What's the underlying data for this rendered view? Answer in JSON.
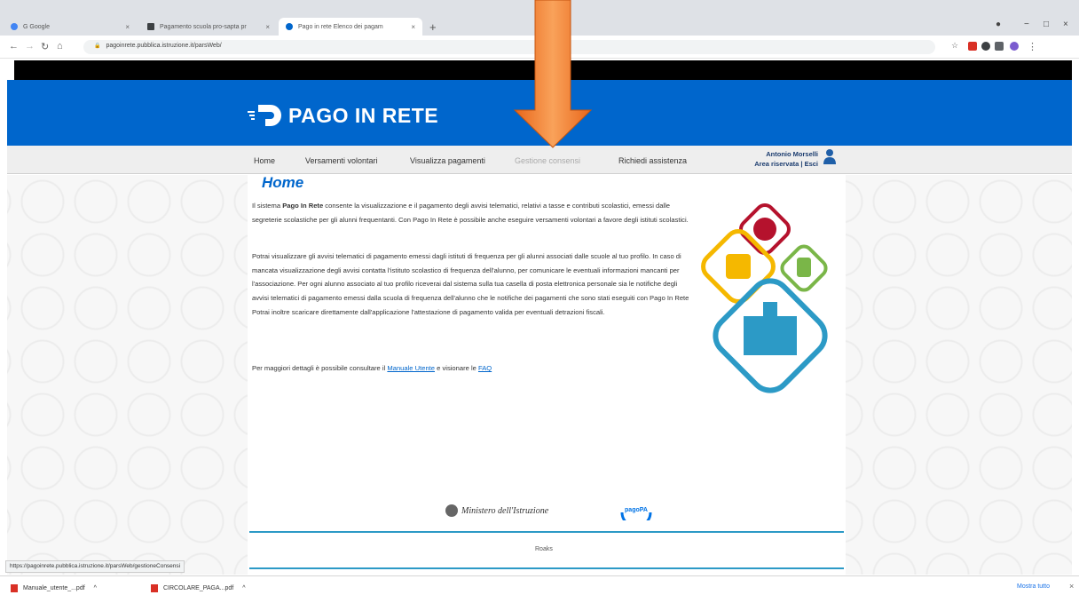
{
  "browser": {
    "tabs": [
      {
        "label": "G Google",
        "active": false,
        "favicon_color": "#4285f4"
      },
      {
        "label": "Pagamento scuola pro-sapta pr",
        "active": false,
        "favicon_color": "#3c4043"
      },
      {
        "label": "Pago in rete Elenco dei pagam",
        "active": true,
        "favicon_color": "#0066cc"
      }
    ],
    "url": "pagoinrete.pubblica.istruzione.it/parsWeb/",
    "new_tab_symbol": "+",
    "window_controls": {
      "minimize": "−",
      "maximize": "□",
      "close": "×"
    }
  },
  "site": {
    "logo_text": "PAGO IN RETE",
    "brand_color": "#0066cc",
    "nav": [
      {
        "label": "Home"
      },
      {
        "label": "Versamenti volontari"
      },
      {
        "label": "Visualizza pagamenti"
      },
      {
        "label": "Gestione consensi"
      },
      {
        "label": "Richiedi assistenza"
      }
    ],
    "user": {
      "name": "Antonio Morselli",
      "area": "Area riservata | Esci"
    }
  },
  "main": {
    "title": "Home",
    "paragraph1_prefix": "Il sistema ",
    "paragraph1_bold": "Pago In Rete",
    "paragraph1_rest": " consente la visualizzazione e il pagamento degli avvisi telematici, relativi a tasse e contributi scolastici, emessi dalle segreterie scolastiche per gli alunni frequentanti. Con Pago In Rete è possibile anche eseguire versamenti volontari a favore degli istituti scolastici.",
    "paragraph2": "Potrai visualizzare gli avvisi telematici di pagamento emessi dagli istituti di frequenza per gli alunni associati dalle scuole al tuo profilo. In caso di mancata visualizzazione degli avvisi contatta l'istituto scolastico di frequenza dell'alunno, per comunicare le eventuali informazioni mancanti per l'associazione. Per ogni alunno associato al tuo profilo riceverai dal sistema sulla tua casella di posta elettronica personale sia le notifiche degli avvisi telematici di pagamento emessi dalla scuola di frequenza dell'alunno che le notifiche dei pagamenti che sono stati eseguiti con Pago In Rete Potrai inoltre scaricare direttamente dall'applicazione l'attestazione di pagamento valida per eventuali detrazioni fiscali.",
    "paragraph3_prefix": "Per maggiori dettagli è possibile consultare il ",
    "manual_link": "Manuale Utente",
    "paragraph3_mid": " e visionare le ",
    "faq_link": "FAQ"
  },
  "footer": {
    "ministry": "Ministero dell'Istruzione",
    "pagopa": "pagoPA",
    "text": "Roaks"
  },
  "status_url": "https://pagoinrete.pubblica.istruzione.it/parsWeb/gestioneConsensi",
  "downloads": {
    "items": [
      {
        "name": "Manuale_utente_...pdf"
      },
      {
        "name": "CIRCOLARE_PAGA...pdf"
      }
    ],
    "show_all": "Mostra tutto",
    "close": "×"
  },
  "overlay": {
    "arrow_color": "#f47c20"
  }
}
